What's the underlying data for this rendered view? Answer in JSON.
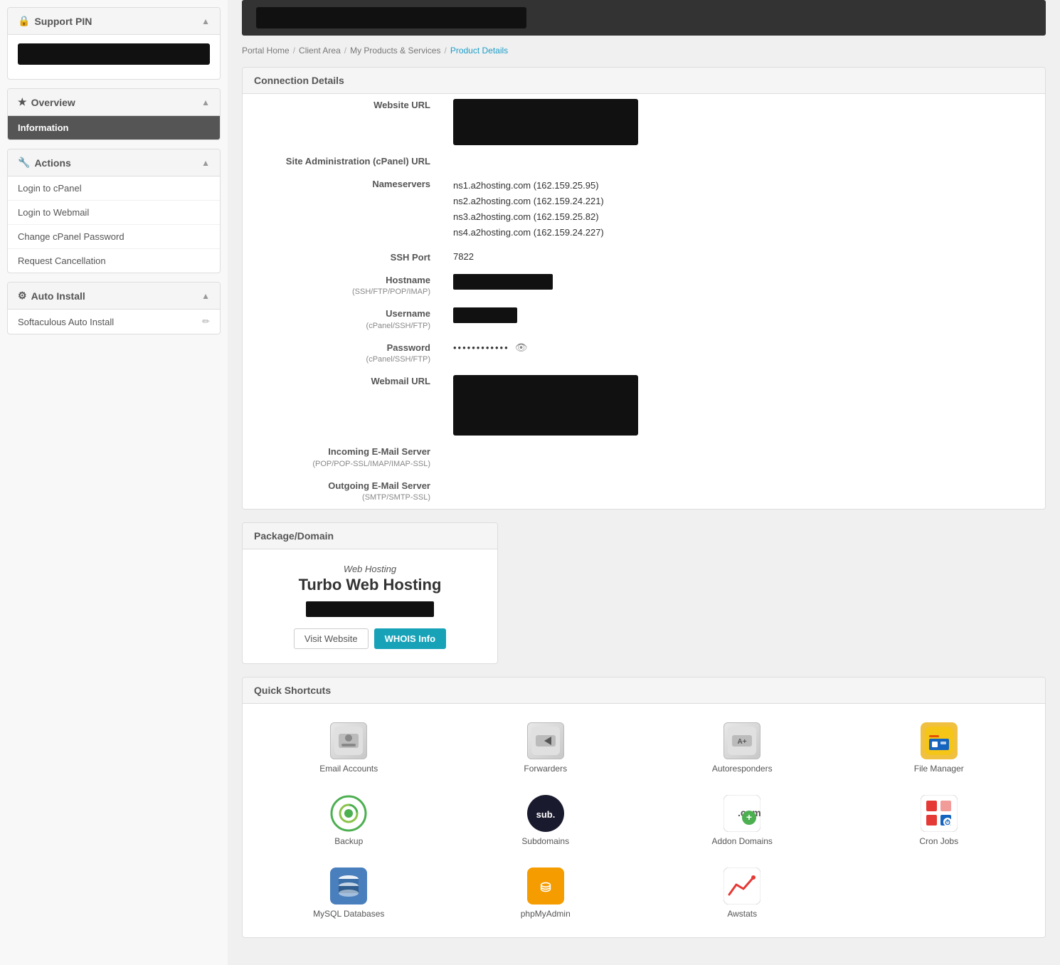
{
  "sidebar": {
    "support_pin_label": "Support PIN",
    "overview_label": "Overview",
    "information_label": "Information",
    "actions_label": "Actions",
    "auto_install_label": "Auto Install",
    "actions_items": [
      {
        "label": "Login to cPanel",
        "id": "login-cpanel"
      },
      {
        "label": "Login to Webmail",
        "id": "login-webmail"
      },
      {
        "label": "Change cPanel Password",
        "id": "change-password"
      },
      {
        "label": "Request Cancellation",
        "id": "request-cancel"
      }
    ],
    "softaculous_label": "Softaculous Auto Install"
  },
  "breadcrumb": {
    "portal_home": "Portal Home",
    "client_area": "Client Area",
    "my_products": "My Products & Services",
    "product_details": "Product Details"
  },
  "connection_details": {
    "title": "Connection Details",
    "website_url_label": "Website URL",
    "site_admin_label": "Site Administration (cPanel) URL",
    "nameservers_label": "Nameservers",
    "nameservers_values": [
      "ns1.a2hosting.com (162.159.25.95)",
      "ns2.a2hosting.com (162.159.24.221)",
      "ns3.a2hosting.com (162.159.25.82)",
      "ns4.a2hosting.com (162.159.24.227)"
    ],
    "ssh_port_label": "SSH Port",
    "ssh_port_value": "7822",
    "hostname_label": "Hostname",
    "hostname_sublabel": "(SSH/FTP/POP/IMAP)",
    "username_label": "Username",
    "username_sublabel": "(cPanel/SSH/FTP)",
    "password_label": "Password",
    "password_sublabel": "(cPanel/SSH/FTP)",
    "password_dots": "••••••••••••",
    "webmail_url_label": "Webmail URL",
    "incoming_email_label": "Incoming E-Mail Server",
    "incoming_email_sublabel": "(POP/POP-SSL/IMAP/IMAP-SSL)",
    "outgoing_email_label": "Outgoing E-Mail Server",
    "outgoing_email_sublabel": "(SMTP/SMTP-SSL)"
  },
  "package": {
    "title": "Package/Domain",
    "type": "Web Hosting",
    "name": "Turbo Web Hosting",
    "visit_website_label": "Visit Website",
    "whois_label": "WHOIS Info"
  },
  "shortcuts": {
    "title": "Quick Shortcuts",
    "items": [
      {
        "label": "Email Accounts",
        "icon": "email",
        "id": "email-accounts"
      },
      {
        "label": "Forwarders",
        "icon": "forwarders",
        "id": "forwarders"
      },
      {
        "label": "Autoresponders",
        "icon": "autoresponders",
        "id": "autoresponders"
      },
      {
        "label": "File Manager",
        "icon": "file-manager",
        "id": "file-manager"
      },
      {
        "label": "Backup",
        "icon": "backup",
        "id": "backup"
      },
      {
        "label": "Subdomains",
        "icon": "subdomains",
        "id": "subdomains"
      },
      {
        "label": "Addon Domains",
        "icon": "addon-domains",
        "id": "addon-domains"
      },
      {
        "label": "Cron Jobs",
        "icon": "cron-jobs",
        "id": "cron-jobs"
      },
      {
        "label": "MySQL Databases",
        "icon": "mysql",
        "id": "mysql-databases"
      },
      {
        "label": "phpMyAdmin",
        "icon": "phpmyadmin",
        "id": "phpmyadmin"
      },
      {
        "label": "Awstats",
        "icon": "awstats",
        "id": "awstats"
      }
    ]
  }
}
